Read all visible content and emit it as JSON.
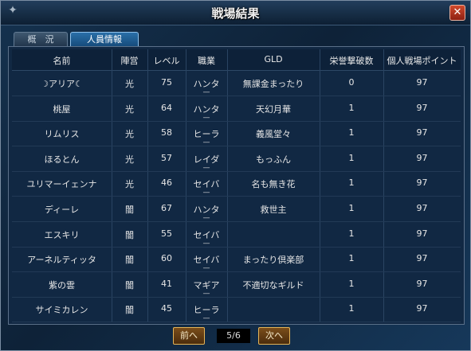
{
  "window": {
    "title": "戦場結果",
    "close_label": "✕"
  },
  "tabs": [
    {
      "label": "概　況"
    },
    {
      "label": "人員情報"
    }
  ],
  "table": {
    "headers": [
      "名前",
      "陣営",
      "レベル",
      "職業",
      "GLD",
      "栄誉撃破数",
      "個人戦場ポイント"
    ],
    "rows": [
      {
        "name": "☽アリア☾",
        "faction": "光",
        "level": "75",
        "job": "ハンタ",
        "gld": "無課金まったり",
        "kills": "0",
        "points": "97"
      },
      {
        "name": "桃屋",
        "faction": "光",
        "level": "64",
        "job": "ハンタ",
        "gld": "天幻月華",
        "kills": "1",
        "points": "97"
      },
      {
        "name": "リムリス",
        "faction": "光",
        "level": "58",
        "job": "ヒーラ",
        "gld": "義風堂々",
        "kills": "1",
        "points": "97"
      },
      {
        "name": "ほるとん",
        "faction": "光",
        "level": "57",
        "job": "レイダ",
        "gld": "もっふん",
        "kills": "1",
        "points": "97"
      },
      {
        "name": "ユリマーイェンナ",
        "faction": "光",
        "level": "46",
        "job": "セイバ",
        "gld": "名も無き花",
        "kills": "1",
        "points": "97"
      },
      {
        "name": "ディーレ",
        "faction": "闇",
        "level": "67",
        "job": "ハンタ",
        "gld": "救世主",
        "kills": "1",
        "points": "97"
      },
      {
        "name": "エスキリ",
        "faction": "闇",
        "level": "55",
        "job": "セイバ",
        "gld": "",
        "kills": "1",
        "points": "97"
      },
      {
        "name": "アーネルティッタ",
        "faction": "闇",
        "level": "60",
        "job": "セイバ",
        "gld": "まったり倶楽部",
        "kills": "1",
        "points": "97"
      },
      {
        "name": "紫の雲",
        "faction": "闇",
        "level": "41",
        "job": "マギア",
        "gld": "不適切なギルド",
        "kills": "1",
        "points": "97"
      },
      {
        "name": "サイミカレン",
        "faction": "闇",
        "level": "45",
        "job": "ヒーラ",
        "gld": "",
        "kills": "1",
        "points": "97"
      }
    ]
  },
  "pager": {
    "prev_label": "前へ",
    "next_label": "次へ",
    "page": "5/6"
  }
}
